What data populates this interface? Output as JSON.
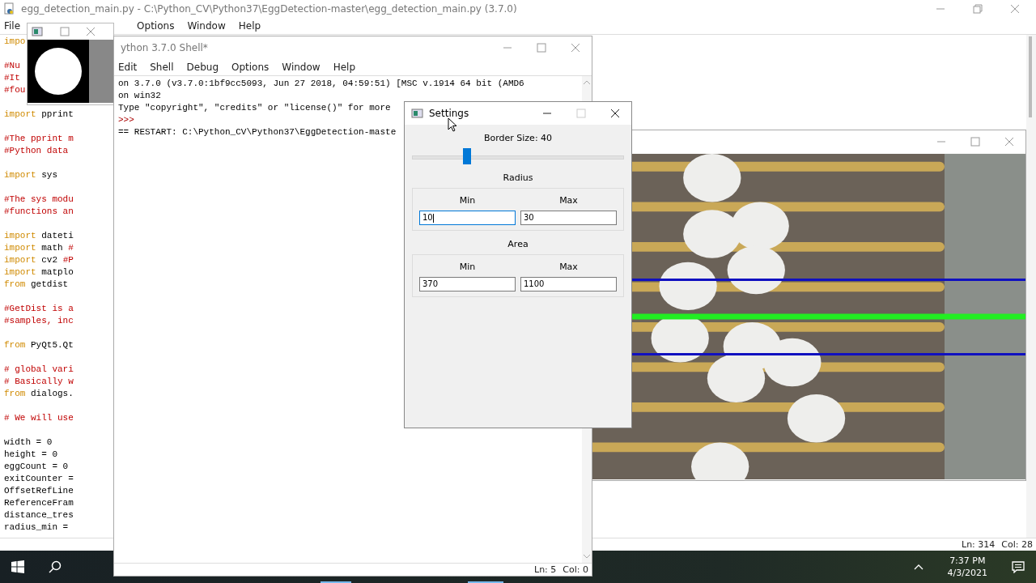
{
  "editor": {
    "title": "egg_detection_main.py - C:\\Python_CV\\Python37\\EggDetection-master\\egg_detection_main.py (3.7.0)",
    "menu": [
      "File",
      "Options",
      "Window",
      "Help"
    ],
    "code_blocks": [
      [
        [
          {
            "kind": "keyword",
            "text": "impo"
          }
        ]
      ],
      [
        [
          {
            "kind": "comment",
            "text": "#Nu"
          }
        ],
        [
          {
            "kind": "comment",
            "text": "#It"
          }
        ],
        [
          {
            "kind": "comment",
            "text": "#fou"
          }
        ]
      ],
      [
        [
          {
            "kind": "keyword",
            "text": "import"
          },
          {
            "kind": "plain",
            "text": " pprint"
          }
        ]
      ],
      [
        [
          {
            "kind": "comment",
            "text": "#The pprint m"
          }
        ],
        [
          {
            "kind": "comment",
            "text": "#Python data"
          }
        ]
      ],
      [
        [
          {
            "kind": "keyword",
            "text": "import"
          },
          {
            "kind": "plain",
            "text": " sys"
          }
        ]
      ],
      [
        [
          {
            "kind": "comment",
            "text": "#The sys modu"
          }
        ],
        [
          {
            "kind": "comment",
            "text": "#functions an"
          }
        ]
      ],
      [
        [
          {
            "kind": "keyword",
            "text": "import"
          },
          {
            "kind": "plain",
            "text": " dateti"
          }
        ],
        [
          {
            "kind": "keyword",
            "text": "import"
          },
          {
            "kind": "plain",
            "text": " math "
          },
          {
            "kind": "comment",
            "text": "#"
          }
        ],
        [
          {
            "kind": "keyword",
            "text": "import"
          },
          {
            "kind": "plain",
            "text": " cv2 "
          },
          {
            "kind": "comment",
            "text": "#P"
          }
        ],
        [
          {
            "kind": "keyword",
            "text": "import"
          },
          {
            "kind": "plain",
            "text": " matplo"
          }
        ],
        [
          {
            "kind": "keyword",
            "text": "from"
          },
          {
            "kind": "plain",
            "text": " getdist"
          }
        ]
      ],
      [
        [
          {
            "kind": "comment",
            "text": "#GetDist is a"
          }
        ],
        [
          {
            "kind": "comment",
            "text": "#samples, inc"
          }
        ]
      ],
      [
        [
          {
            "kind": "keyword",
            "text": "from"
          },
          {
            "kind": "plain",
            "text": " PyQt5.Qt"
          }
        ]
      ],
      [
        [
          {
            "kind": "comment",
            "text": "# global vari"
          }
        ],
        [
          {
            "kind": "comment",
            "text": "# Basically w"
          }
        ],
        [
          {
            "kind": "keyword",
            "text": "from"
          },
          {
            "kind": "plain",
            "text": " dialogs."
          }
        ]
      ],
      [
        [
          {
            "kind": "comment",
            "text": "# We will use"
          }
        ]
      ],
      [
        [
          {
            "kind": "plain",
            "text": "width = 0"
          }
        ],
        [
          {
            "kind": "plain",
            "text": "height = 0"
          }
        ],
        [
          {
            "kind": "plain",
            "text": "eggCount = 0"
          }
        ],
        [
          {
            "kind": "plain",
            "text": "exitCounter ="
          }
        ],
        [
          {
            "kind": "plain",
            "text": "OffsetRefLine"
          }
        ],
        [
          {
            "kind": "plain",
            "text": "ReferenceFram"
          }
        ],
        [
          {
            "kind": "plain",
            "text": "distance_tres"
          }
        ],
        [
          {
            "kind": "plain",
            "text": "radius_min ="
          }
        ]
      ]
    ],
    "status": {
      "line": "Ln: 314",
      "column": "Col: 28"
    }
  },
  "shell": {
    "title": "ython 3.7.0 Shell*",
    "menu": [
      "Edit",
      "Shell",
      "Debug",
      "Options",
      "Window",
      "Help"
    ],
    "lines": [
      {
        "kind": "output",
        "text": "on 3.7.0 (v3.7.0:1bf9cc5093, Jun 27 2018, 04:59:51) [MSC v.1914 64 bit (AMD6"
      },
      {
        "kind": "output",
        "text": "on win32"
      },
      {
        "kind": "output",
        "text": "Type \"copyright\", \"credits\" or \"license()\" for more"
      },
      {
        "kind": "prompt",
        "text": ">>>"
      },
      {
        "kind": "output",
        "text": "== RESTART: C:\\Python_CV\\Python37\\EggDetection-maste"
      }
    ],
    "status": {
      "line": "Ln: 5",
      "column": "Col: 0"
    }
  },
  "settings": {
    "title": "Settings",
    "border": {
      "label": "Border Size: 40",
      "level": 0.26
    },
    "groups": [
      {
        "title": "Radius",
        "fields": [
          {
            "label": "Min",
            "value": "10",
            "focused": true
          },
          {
            "label": "Max",
            "value": "30",
            "focused": false
          }
        ]
      },
      {
        "title": "Area",
        "fields": [
          {
            "label": "Min",
            "value": "370",
            "focused": false
          },
          {
            "label": "Max",
            "value": "1100",
            "focused": false
          }
        ]
      }
    ]
  },
  "taskbar": {
    "time": "7:37 PM",
    "date": "4/3/2021"
  }
}
